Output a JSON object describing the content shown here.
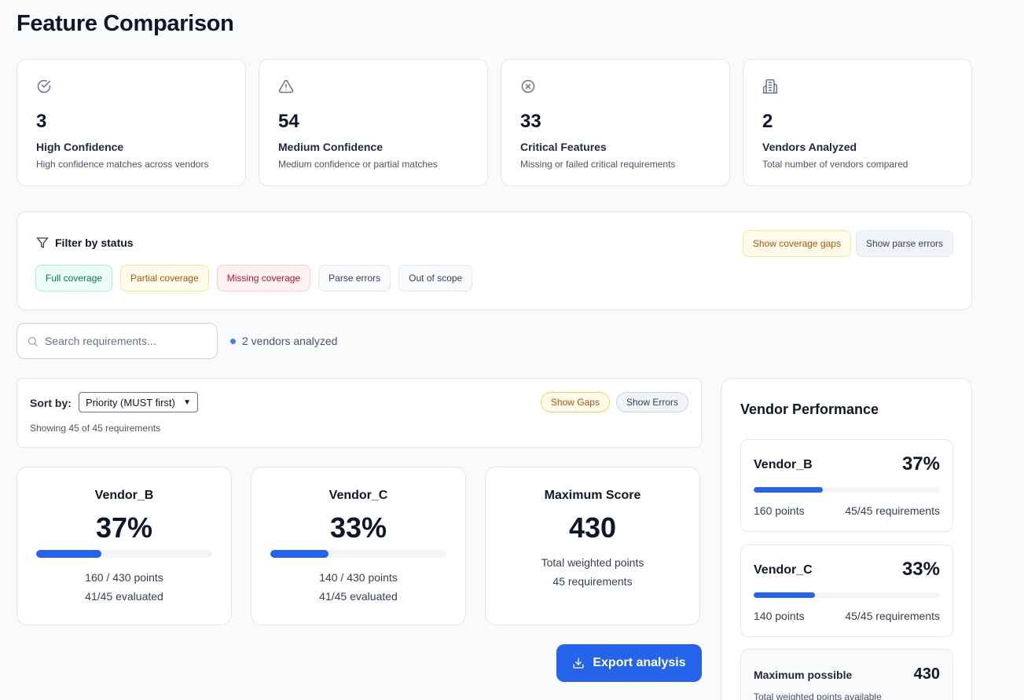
{
  "page": {
    "title": "Feature Comparison"
  },
  "stats": [
    {
      "icon": "check-circle-icon",
      "value": "3",
      "label": "High Confidence",
      "desc": "High confidence matches across vendors"
    },
    {
      "icon": "warning-triangle-icon",
      "value": "54",
      "label": "Medium Confidence",
      "desc": "Medium confidence or partial matches"
    },
    {
      "icon": "x-circle-icon",
      "value": "33",
      "label": "Critical Features",
      "desc": "Missing or failed critical requirements"
    },
    {
      "icon": "building-icon",
      "value": "2",
      "label": "Vendors Analyzed",
      "desc": "Total number of vendors compared"
    }
  ],
  "filter": {
    "title": "Filter by status",
    "actions": {
      "coverage_gaps": "Show coverage gaps",
      "parse_errors": "Show parse errors"
    },
    "chips": [
      "Full coverage",
      "Partial coverage",
      "Missing coverage",
      "Parse errors",
      "Out of scope"
    ]
  },
  "search": {
    "placeholder": "Search requirements...",
    "value": ""
  },
  "vendors_analyzed_text": "2 vendors analyzed",
  "sort": {
    "label": "Sort by:",
    "selected": "Priority (MUST first)",
    "showing": "Showing 45 of 45 requirements",
    "show_gaps": "Show Gaps",
    "show_errors": "Show Errors"
  },
  "scores": [
    {
      "name": "Vendor_B",
      "pct": "37%",
      "fill": 0.37,
      "points": "160 / 430 points",
      "evaluated": "41/45 evaluated"
    },
    {
      "name": "Vendor_C",
      "pct": "33%",
      "fill": 0.33,
      "points": "140 / 430 points",
      "evaluated": "41/45 evaluated"
    }
  ],
  "max_score": {
    "title": "Maximum Score",
    "value": "430",
    "line1": "Total weighted points",
    "line2": "45 requirements"
  },
  "export_label": "Export analysis",
  "performance": {
    "title": "Vendor Performance",
    "vendors": [
      {
        "name": "Vendor_B",
        "pct": "37%",
        "fill": 0.37,
        "points": "160 points",
        "reqs": "45/45 requirements"
      },
      {
        "name": "Vendor_C",
        "pct": "33%",
        "fill": 0.33,
        "points": "140 points",
        "reqs": "45/45 requirements"
      }
    ],
    "max": {
      "label": "Maximum possible",
      "value": "430",
      "desc": "Total weighted points available"
    }
  },
  "colors": {
    "accent": "#2563eb",
    "dot": "#3b82f6"
  }
}
